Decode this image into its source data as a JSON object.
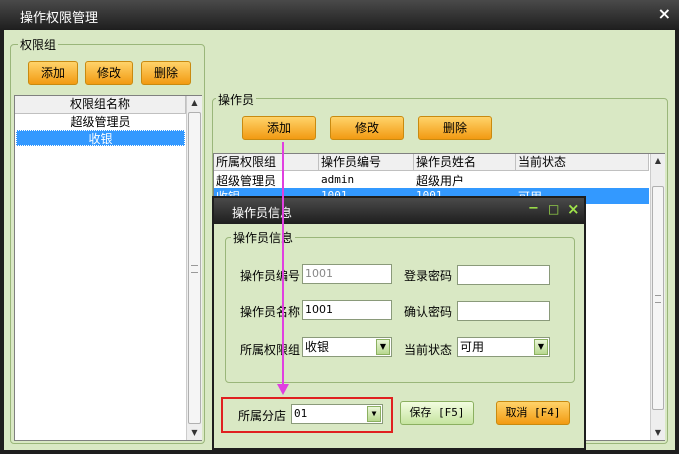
{
  "window": {
    "title": "操作权限管理",
    "close_glyph": "×"
  },
  "perm_group": {
    "legend": "权限组",
    "buttons": {
      "add": "添加",
      "edit": "修改",
      "delete": "删除"
    },
    "list_header": "权限组名称",
    "items": [
      "超级管理员",
      "收银"
    ],
    "selected_index": 1
  },
  "operators": {
    "legend": "操作员",
    "buttons": {
      "add": "添加",
      "edit": "修改",
      "delete": "删除"
    },
    "columns": [
      "所属权限组",
      "操作员编号",
      "操作员姓名",
      "当前状态"
    ],
    "rows": [
      [
        "超级管理员",
        "admin",
        "超级用户",
        ""
      ],
      [
        "收银",
        "1001",
        "1001",
        "可用"
      ]
    ],
    "selected_row": 1
  },
  "dialog": {
    "title": "操作员信息",
    "controls": {
      "minimize": "−",
      "maximize": "□",
      "close": "×"
    },
    "group_legend": "操作员信息",
    "fields": {
      "op_no_label": "操作员编号",
      "op_no_value": "1001",
      "login_pwd_label": "登录密码",
      "login_pwd_value": "",
      "op_name_label": "操作员名称",
      "op_name_value": "1001",
      "confirm_pwd_label": "确认密码",
      "confirm_pwd_value": "",
      "group_label": "所属权限组",
      "group_value": "收银",
      "status_label": "当前状态",
      "status_value": "可用",
      "branch_label": "所属分店",
      "branch_value": "01"
    },
    "save_label": "保存 [F5]",
    "cancel_label": "取消 [F4]"
  },
  "icons": {
    "scroll_up": "▲",
    "scroll_down": "▼",
    "combo_arrow": "▼"
  },
  "colors": {
    "accent_orange": "#f29a12",
    "selection": "#3399ff",
    "highlight_red": "#e02020",
    "arrow_magenta": "#e040e0",
    "background": "#d9e8c4"
  }
}
